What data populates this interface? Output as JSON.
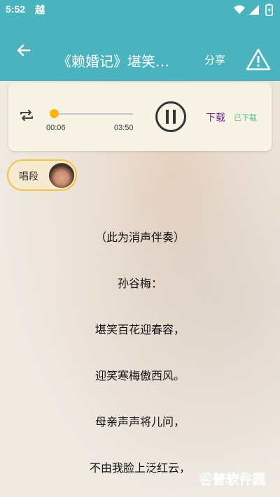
{
  "status_bar": {
    "time": "5:52",
    "app_glyph": "越",
    "icons": [
      "wifi-icon",
      "signal-icon",
      "battery-icon"
    ]
  },
  "app_bar": {
    "title": "《赖婚记》堪笑…",
    "share_label": "分享",
    "icons": [
      "back-arrow-icon",
      "warning-triangle-icon"
    ]
  },
  "player": {
    "current_time": "00:06",
    "duration": "03:50",
    "progress": 0.03,
    "download_label": "下载",
    "downloaded_label": "已下载",
    "icons": [
      "repeat-icon",
      "pause-icon"
    ]
  },
  "chip": {
    "label": "唱段"
  },
  "lyrics": [
    "（此为消声伴奏）",
    "孙谷梅：",
    "堪笑百花迎春容，",
    "迎笑寒梅傲西风。",
    "母亲声声将儿问，",
    "不由我脸上泛红云，"
  ],
  "watermark": {
    "text": "谷普软件园"
  },
  "colors": {
    "header": "#4bb3bd",
    "accent": "#f6b60d",
    "download": "#7a2b8c",
    "downloaded": "#5bbf85"
  }
}
